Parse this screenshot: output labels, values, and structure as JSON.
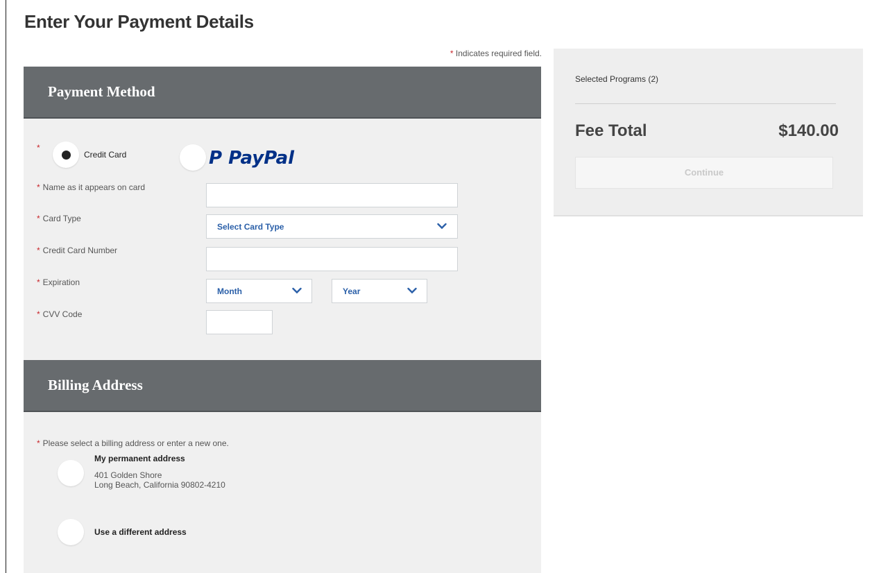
{
  "page": {
    "title": "Enter Your Payment Details",
    "required_star": "*",
    "required_note": "Indicates required field."
  },
  "payment": {
    "heading": "Payment Method",
    "options": {
      "credit_card": "Credit Card",
      "paypal_p": "P",
      "paypal_text": "PayPal"
    },
    "fields": {
      "name_label": "Name as it appears on card",
      "card_type_label": "Card Type",
      "card_type_value": "Select Card Type",
      "card_number_label": "Credit Card Number",
      "expiration_label": "Expiration",
      "month_value": "Month",
      "year_value": "Year",
      "cvv_label": "CVV Code"
    }
  },
  "billing": {
    "heading": "Billing Address",
    "prompt": "Please select a billing address or enter a new one.",
    "permanent_title": "My permanent address",
    "permanent_line1": "401 Golden Shore",
    "permanent_line2": "Long Beach, California 90802-4210",
    "different_label": "Use a different address"
  },
  "summary": {
    "selected_programs": "Selected Programs (2)",
    "fee_label": "Fee Total",
    "fee_value": "$140.00",
    "continue_label": "Continue"
  },
  "colors": {
    "section_header": "#676b6e",
    "required_star": "#c8262b",
    "select_text": "#2a5fa8",
    "paypal_dark": "#003087",
    "paypal_light": "#009cde"
  },
  "icons": {
    "chevron": "chevron-down-icon",
    "paypal": "paypal-logo"
  }
}
